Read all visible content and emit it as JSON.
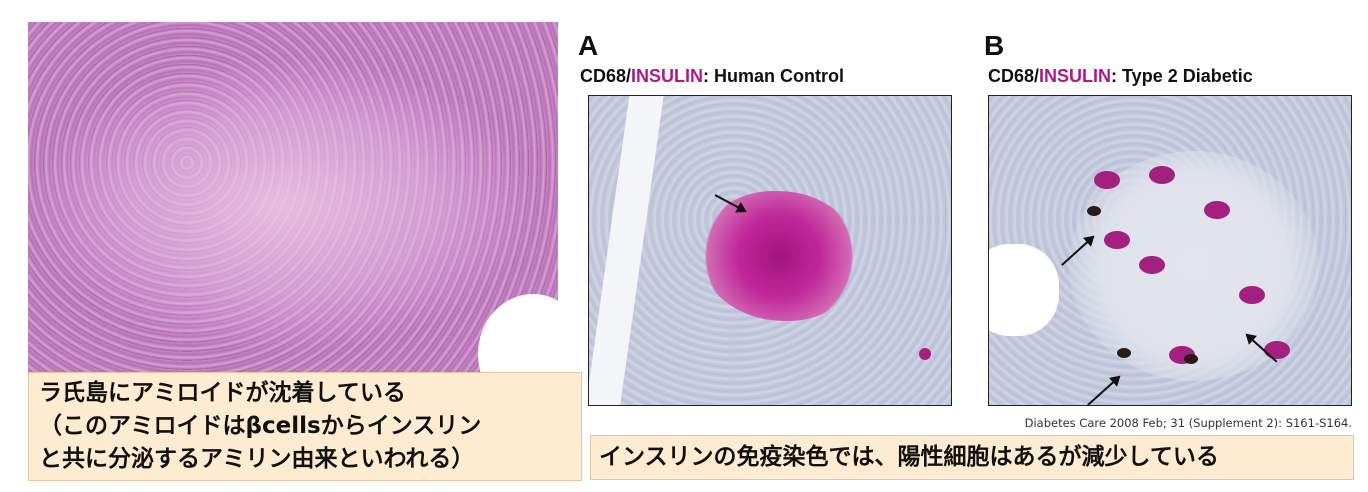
{
  "left_figure": {
    "caption_lines": [
      "ラ氏島にアミロイドが沈着している",
      "（このアミロイドはβcellsからインスリン",
      "と共に分泌するアミリン由来といわれる）"
    ]
  },
  "panel_a": {
    "letter": "A",
    "title_prefix": "CD68/",
    "title_stain": "INSULIN",
    "title_suffix": ": Human Control"
  },
  "panel_b": {
    "letter": "B",
    "title_prefix": "CD68/",
    "title_stain": "INSULIN",
    "title_suffix": ": Type 2 Diabetic"
  },
  "citation": "Diabetes Care 2008 Feb; 31 (Supplement 2): S161-S164.",
  "right_caption": "インスリンの免疫染色では、陽性細胞はあるが減少している",
  "colors": {
    "stain_accent": "#b0178f",
    "caption_bg": "#fdebd2"
  }
}
